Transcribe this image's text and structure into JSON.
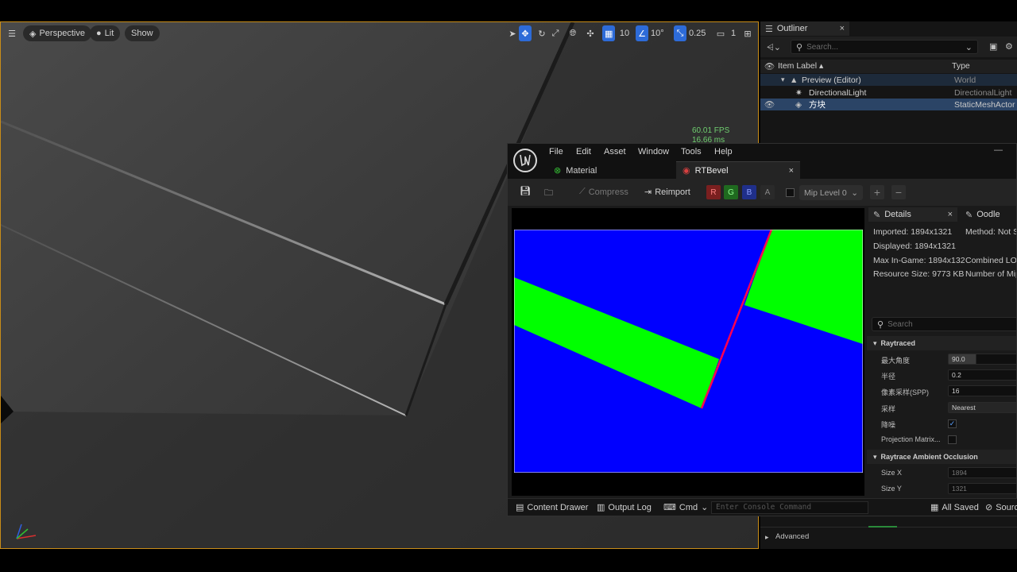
{
  "viewport": {
    "view_mode": "Perspective",
    "lighting": "Lit",
    "show": "Show",
    "grid_snap": "10",
    "rotate_snap": "10°",
    "scale_snap": "0.25",
    "camera_speed": "1",
    "fps": "60.01 FPS",
    "frame_ms": "16.66 ms"
  },
  "outliner": {
    "tab_title": "Outliner",
    "search_placeholder": "Search...",
    "col_label": "Item Label",
    "col_type": "Type",
    "rows": [
      {
        "label": "Preview (Editor)",
        "type": "World"
      },
      {
        "label": "DirectionalLight",
        "type": "DirectionalLight"
      },
      {
        "label": "方块",
        "type": "StaticMeshActor"
      }
    ],
    "advanced": "Advanced"
  },
  "texture_editor": {
    "menu": [
      "File",
      "Edit",
      "Asset",
      "Window",
      "Tools",
      "Help"
    ],
    "tabs": [
      {
        "label": "Material"
      },
      {
        "label": "RTBevel"
      }
    ],
    "toolbar": {
      "compress": "Compress",
      "reimport": "Reimport",
      "channels": [
        "R",
        "G",
        "B",
        "A"
      ],
      "mip_level": "Mip Level 0",
      "plus": "+",
      "minus": "−"
    },
    "details": {
      "tab_details": "Details",
      "tab_oodle": "Oodle",
      "info_left": [
        "Imported: 1894x1321",
        "Displayed: 1894x1321",
        "Max In-Game: 1894x132",
        "Resource Size: 9773 KB"
      ],
      "info_right": [
        "Method: Not St",
        "",
        "Combined LOD",
        "Number of Mip"
      ],
      "search_placeholder": "Search",
      "section_raytraced": "Raytraced",
      "props": [
        {
          "label": "最大角度",
          "value": "90.0"
        },
        {
          "label": "半径",
          "value": "0.2"
        },
        {
          "label": "像素采样(SPP)",
          "value": "16"
        },
        {
          "label": "采样",
          "value": "Nearest"
        },
        {
          "label": "降噪",
          "value": "✓"
        },
        {
          "label": "Projection Matrix...",
          "value": ""
        }
      ],
      "section_ao": "Raytrace Ambient Occlusion",
      "size_props": [
        {
          "label": "Size X",
          "value": "1894"
        },
        {
          "label": "Size Y",
          "value": "1321"
        }
      ]
    },
    "statusbar": {
      "content_drawer": "Content Drawer",
      "output_log": "Output Log",
      "cmd": "Cmd",
      "console_placeholder": "Enter Console Command",
      "all_saved": "All Saved",
      "source": "Sourc"
    }
  },
  "colors": {
    "accent_blue": "#2d6bd8",
    "viewport_border": "#c98d18",
    "texture_blue": "#0000ff",
    "texture_green": "#00ff00",
    "texture_red": "#ff0040"
  }
}
